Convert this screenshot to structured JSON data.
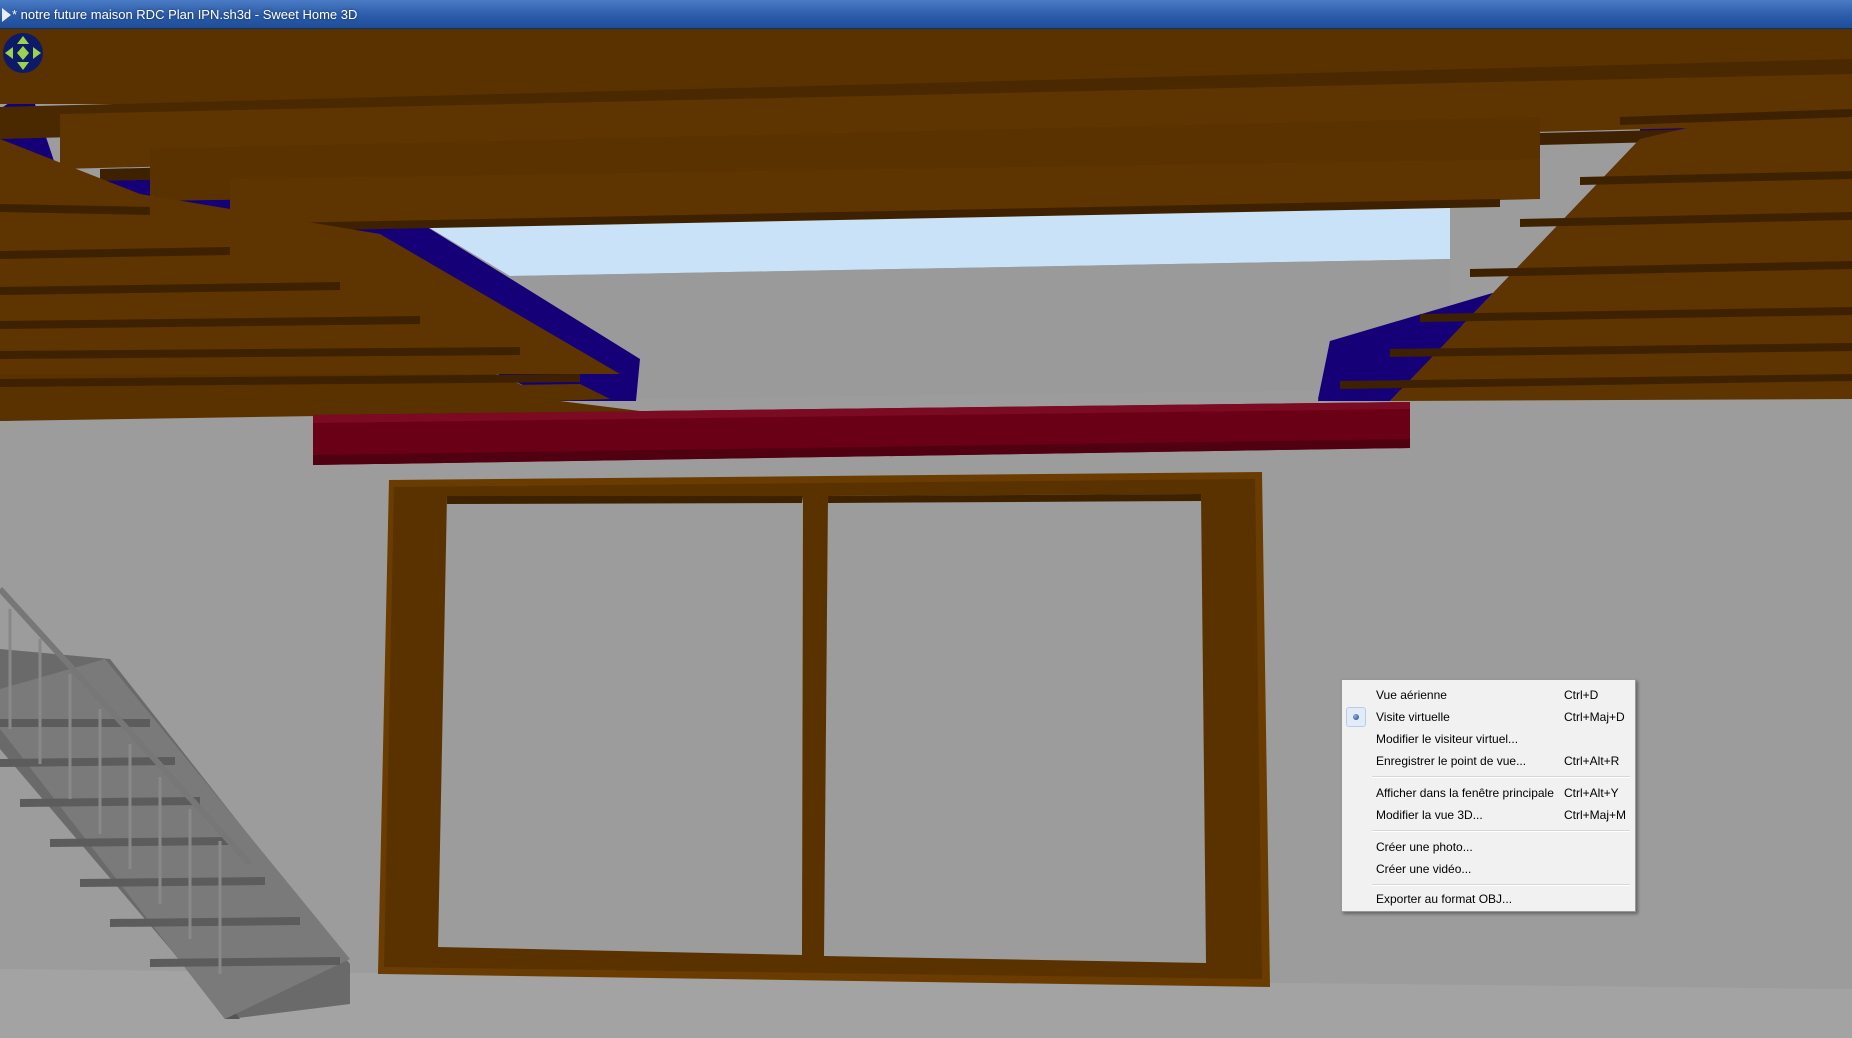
{
  "window": {
    "title": "* notre future maison RDC Plan IPN.sh3d - Sweet Home 3D"
  },
  "navigation": {
    "icon": "navigation-arrows-icon"
  },
  "context_menu": {
    "items": [
      {
        "label": "Vue aérienne",
        "shortcut": "Ctrl+D",
        "selected": false
      },
      {
        "label": "Visite virtuelle",
        "shortcut": "Ctrl+Maj+D",
        "selected": true
      },
      {
        "label": "Modifier le visiteur virtuel...",
        "shortcut": "",
        "selected": false
      },
      {
        "label": "Enregistrer le point de vue...",
        "shortcut": "Ctrl+Alt+R",
        "selected": false
      },
      {
        "label": "Afficher dans la fenêtre principale",
        "shortcut": "Ctrl+Alt+Y",
        "selected": false
      },
      {
        "label": "Modifier la vue 3D...",
        "shortcut": "Ctrl+Maj+M",
        "selected": false
      },
      {
        "label": "Créer une photo...",
        "shortcut": "",
        "selected": false
      },
      {
        "label": "Créer une vidéo...",
        "shortcut": "",
        "selected": false
      },
      {
        "label": "Exporter au format OBJ...",
        "shortcut": "",
        "selected": false
      }
    ]
  },
  "colors": {
    "wood_beam": "#5a3200",
    "steel_beam_blue": "#160078",
    "steel_beam_red": "#6a0016",
    "sky": "#c9e2f8",
    "wall": "#9c9c9c",
    "titlebar": "#2a5aa8"
  }
}
